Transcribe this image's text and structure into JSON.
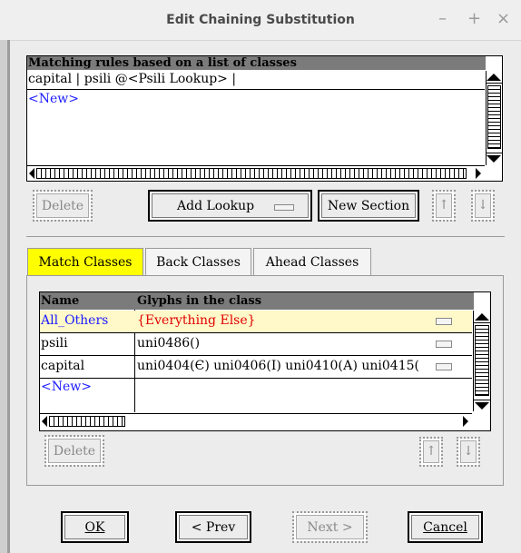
{
  "window": {
    "title": "Edit Chaining Substitution",
    "minimize": "–",
    "maximize": "+",
    "close": "×"
  },
  "rules": {
    "header": "Matching rules based on a list of classes",
    "rows": [
      "capital | psili @<Psili Lookup> |"
    ],
    "new_label": "<New>"
  },
  "rule_buttons": {
    "delete": "Delete",
    "add_lookup": "Add Lookup",
    "new_section": "New Section",
    "up": "↑",
    "down": "↓"
  },
  "tabs": [
    {
      "label": "Match Classes",
      "active": true
    },
    {
      "label": "Back Classes",
      "active": false
    },
    {
      "label": "Ahead Classes",
      "active": false
    }
  ],
  "classes": {
    "col_name": "Name",
    "col_glyphs": "Glyphs in the class",
    "rows": [
      {
        "name": "All_Others",
        "glyphs": "{Everything Else}"
      },
      {
        "name": "psili",
        "glyphs": "uni0486()"
      },
      {
        "name": "capital",
        "glyphs": "uni0404(Є) uni0406(І) uni0410(А) uni0415("
      }
    ],
    "new_label": "<New>"
  },
  "class_buttons": {
    "delete": "Delete",
    "up": "↑",
    "down": "↓"
  },
  "footer": {
    "ok": "OK",
    "prev": "< Prev",
    "next": "Next >",
    "cancel": "Cancel"
  },
  "colors": {
    "link_blue": "#1a1aff",
    "everything_else_red": "#e00000",
    "active_tab": "#ffff00"
  }
}
